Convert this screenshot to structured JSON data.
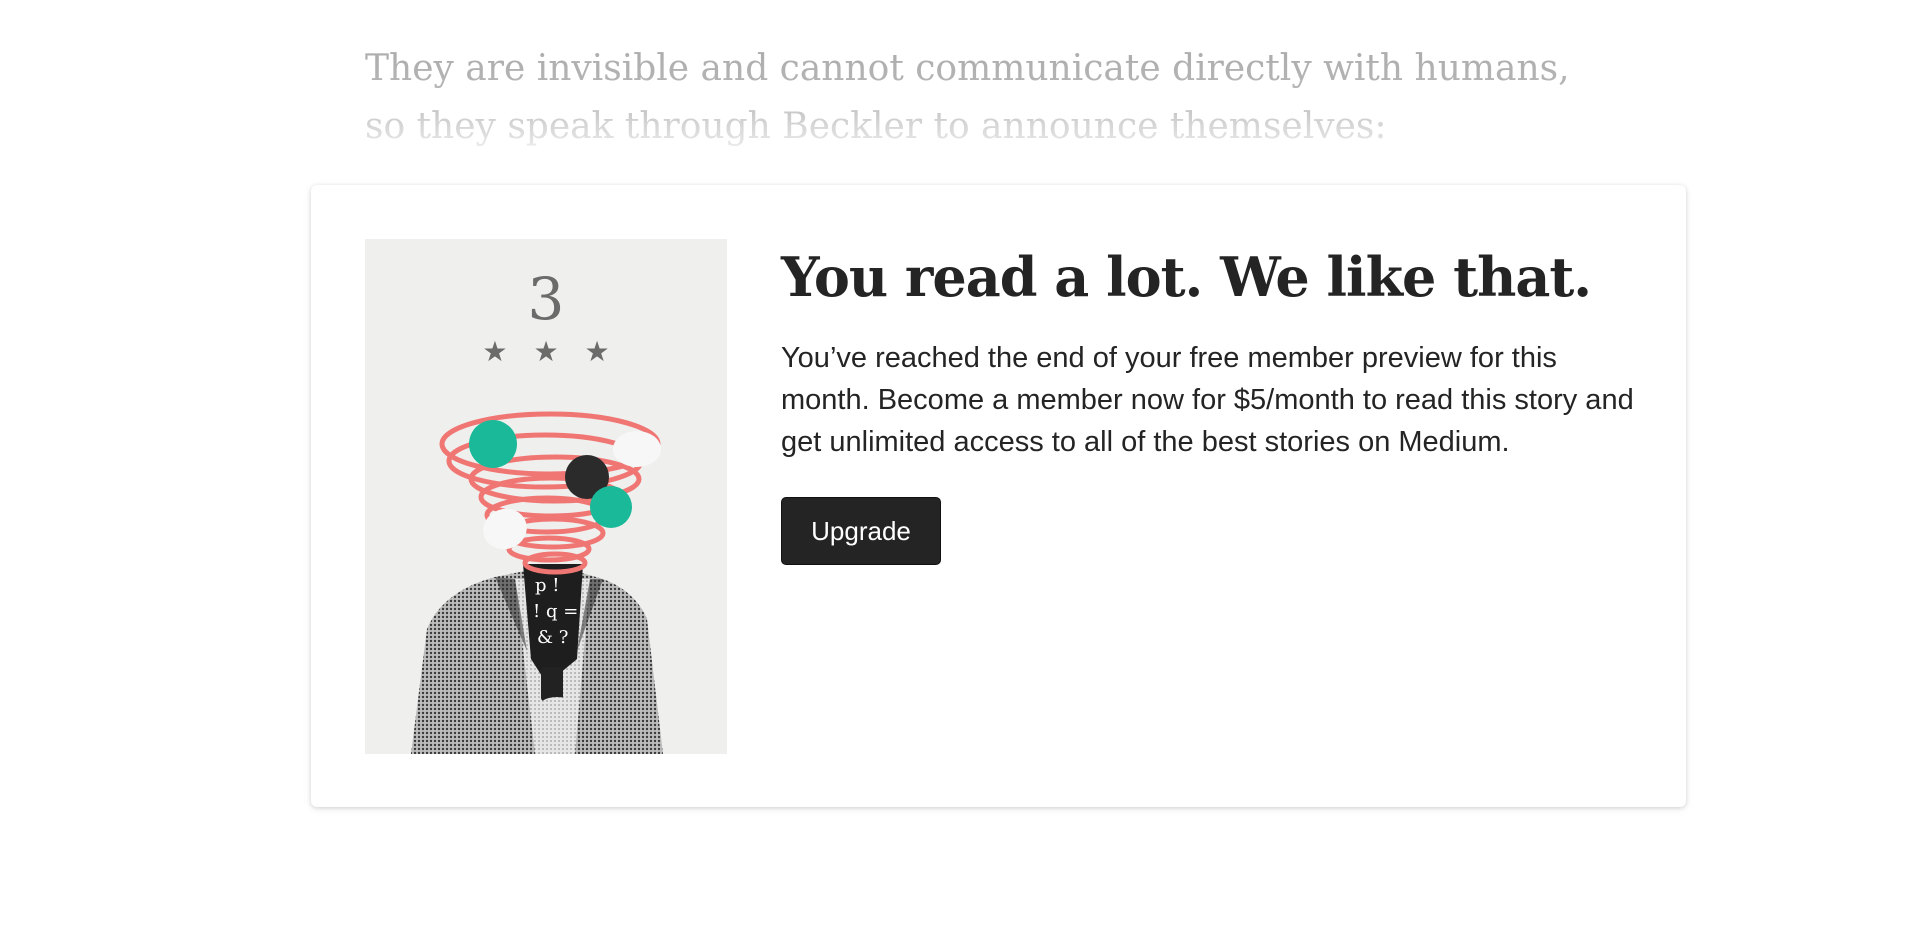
{
  "article": {
    "faded_text": "They are invisible and cannot communicate directly with humans, so they speak through Beckler to announce themselves:"
  },
  "paywall": {
    "illustration": {
      "number": "3",
      "stars": "★★★"
    },
    "title": "You read a lot. We like that.",
    "body": "You’ve reached the end of your free member preview for this month. Become a member now for $5/month to read this story and get unlimited access to all of the best stories on Medium.",
    "button_label": "Upgrade"
  },
  "colors": {
    "text_dark": "#242424",
    "faded_text": "#aaaaaa",
    "button_bg": "#242424",
    "illustration_bg": "#efefed",
    "swirl_red": "#f07674",
    "accent_green": "#1ab99a"
  }
}
